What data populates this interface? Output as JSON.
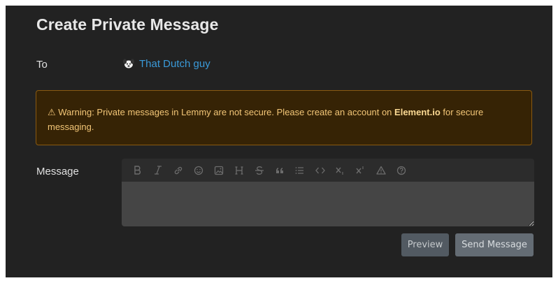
{
  "page": {
    "title": "Create Private Message"
  },
  "recipient": {
    "label": "To",
    "name": "That Dutch guy",
    "avatar_icon": "dog-avatar-icon"
  },
  "warning": {
    "icon": "warning-triangle-icon",
    "prefix": "⚠ Warning: Private messages in Lemmy are not secure. Please create an account on ",
    "link_text": "Element.io",
    "suffix": " for secure messaging."
  },
  "message": {
    "label": "Message",
    "value": "",
    "toolbar": [
      {
        "name": "bold-icon",
        "glyph": "B"
      },
      {
        "name": "italic-icon",
        "glyph": "I"
      },
      {
        "name": "link-icon",
        "glyph": "link"
      },
      {
        "name": "emoji-icon",
        "glyph": "emoji"
      },
      {
        "name": "image-icon",
        "glyph": "image"
      },
      {
        "name": "header-icon",
        "glyph": "H"
      },
      {
        "name": "strikethrough-icon",
        "glyph": "S"
      },
      {
        "name": "quote-icon",
        "glyph": "quote"
      },
      {
        "name": "list-icon",
        "glyph": "list"
      },
      {
        "name": "code-icon",
        "glyph": "code"
      },
      {
        "name": "subscript-icon",
        "glyph": "sub"
      },
      {
        "name": "superscript-icon",
        "glyph": "sup"
      },
      {
        "name": "spoiler-warning-icon",
        "glyph": "warn"
      },
      {
        "name": "help-icon",
        "glyph": "help"
      }
    ]
  },
  "buttons": {
    "preview": "Preview",
    "send": "Send Message"
  },
  "colors": {
    "background": "#222222",
    "link": "#3a9ad9",
    "warning_bg": "#362305",
    "warning_border": "#8a5a10",
    "warning_text": "#f3c677"
  }
}
